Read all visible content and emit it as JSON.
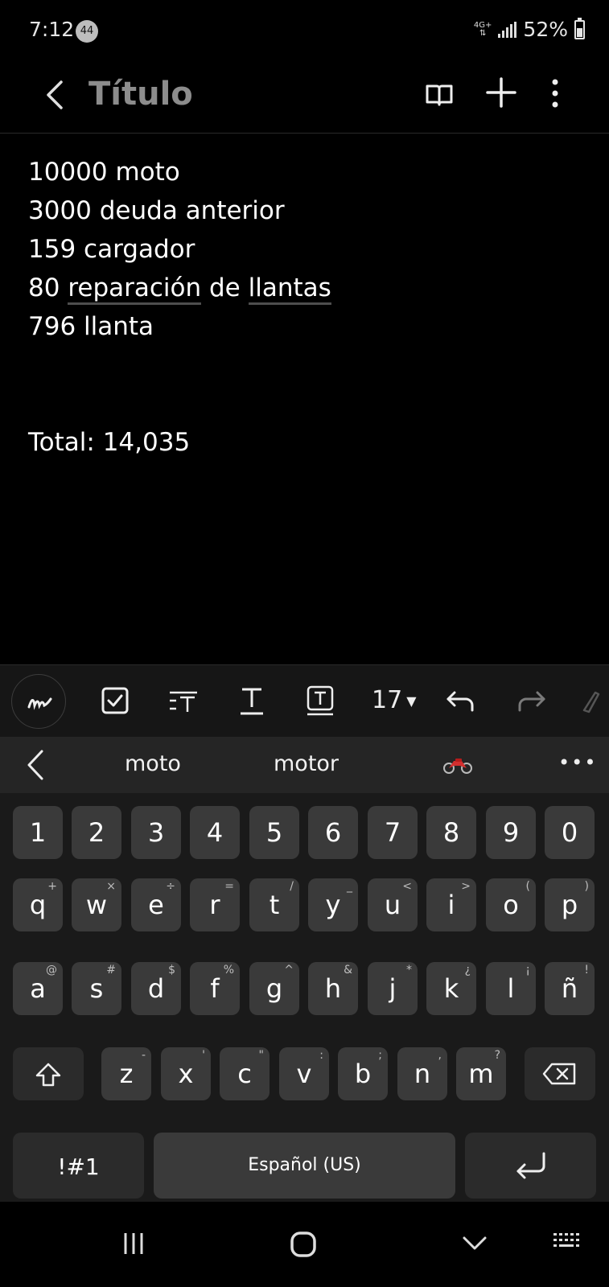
{
  "status_bar": {
    "time": "7:12",
    "notification_count": "44",
    "network": "4G+",
    "battery": "52%"
  },
  "app_bar": {
    "title": "Título"
  },
  "note": {
    "lines": [
      "10000 moto",
      "3000 deuda anterior",
      "159 cargador"
    ],
    "line4_prefix": "80",
    "line4_word1": "reparación",
    "line4_mid": "de",
    "line4_word2": "llantas",
    "line5": "796 llanta",
    "total": "Total: 14,035"
  },
  "toolbar": {
    "font_size": "17"
  },
  "suggestions": {
    "items": [
      "moto",
      "motor"
    ],
    "emoji": "motorcycle"
  },
  "keyboard": {
    "numbers": [
      "1",
      "2",
      "3",
      "4",
      "5",
      "6",
      "7",
      "8",
      "9",
      "0"
    ],
    "row1": [
      {
        "k": "q",
        "h": "+"
      },
      {
        "k": "w",
        "h": "×"
      },
      {
        "k": "e",
        "h": "÷"
      },
      {
        "k": "r",
        "h": "="
      },
      {
        "k": "t",
        "h": "/"
      },
      {
        "k": "y",
        "h": "_"
      },
      {
        "k": "u",
        "h": "<"
      },
      {
        "k": "i",
        "h": ">"
      },
      {
        "k": "o",
        "h": "("
      },
      {
        "k": "p",
        "h": ")"
      }
    ],
    "row2": [
      {
        "k": "a",
        "h": "@"
      },
      {
        "k": "s",
        "h": "#"
      },
      {
        "k": "d",
        "h": "$"
      },
      {
        "k": "f",
        "h": "%"
      },
      {
        "k": "g",
        "h": "^"
      },
      {
        "k": "h",
        "h": "&"
      },
      {
        "k": "j",
        "h": "*"
      },
      {
        "k": "k",
        "h": "¿"
      },
      {
        "k": "l",
        "h": "¡"
      },
      {
        "k": "ñ",
        "h": "!"
      }
    ],
    "row3": [
      {
        "k": "z",
        "h": "-"
      },
      {
        "k": "x",
        "h": "'"
      },
      {
        "k": "c",
        "h": "\""
      },
      {
        "k": "v",
        "h": ":"
      },
      {
        "k": "b",
        "h": ";"
      },
      {
        "k": "n",
        "h": ","
      },
      {
        "k": "m",
        "h": "?"
      }
    ],
    "symbols_label": "!#1",
    "space_label": "Español (US)"
  },
  "colors": {
    "background": "#000000",
    "key": "#3a3a3a",
    "toolbar": "#161616",
    "suggestion_bar": "#252525"
  }
}
